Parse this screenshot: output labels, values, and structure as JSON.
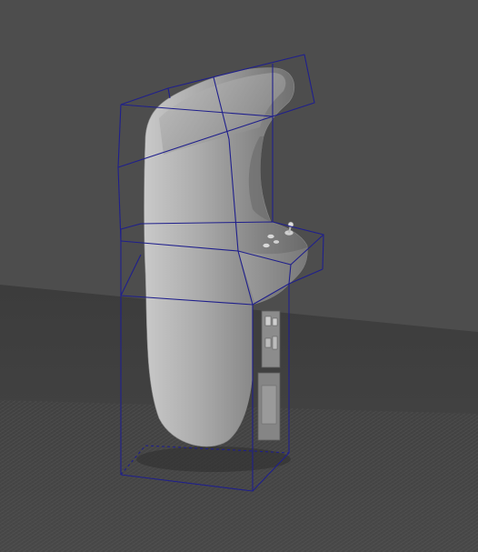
{
  "viewport": {
    "background_color": "#4d4d4d",
    "floor_color": "#3f3f3f",
    "grid_color": "#5a5a5a",
    "cage_color": "#1f1f8c",
    "model_color": "#9a9a9a"
  },
  "scene": {
    "model": "arcade-cabinet",
    "shading": "smooth-gray",
    "cage_visible": true,
    "floor_grid_visible": true
  }
}
